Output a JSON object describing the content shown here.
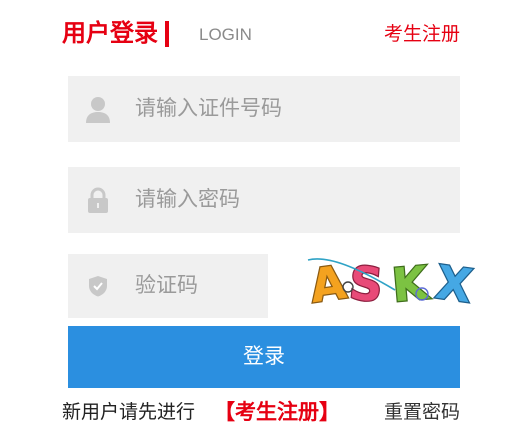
{
  "header": {
    "title": "用户登录",
    "subtitle": "LOGIN",
    "register_link": "考生注册"
  },
  "form": {
    "id_number": {
      "placeholder": "请输入证件号码",
      "icon": "user-icon"
    },
    "password": {
      "placeholder": "请输入密码",
      "icon": "lock-icon"
    },
    "captcha": {
      "placeholder": "验证码",
      "icon": "shield-check-icon"
    },
    "captcha_image": {
      "letters": [
        "A",
        "S",
        "K",
        "X"
      ],
      "colors": [
        "#f4a21f",
        "#e84a78",
        "#7cc242",
        "#45a8e4"
      ]
    },
    "submit_label": "登录"
  },
  "footer": {
    "prompt": "新用户请先进行",
    "register_link": "【考生注册】",
    "reset_password": "重置密码"
  },
  "colors": {
    "accent_red": "#e60012",
    "button_blue": "#2b8fe0",
    "input_background": "#f0f0f0",
    "placeholder": "#9a9a9a",
    "icon_gray": "#c8c8c8"
  }
}
